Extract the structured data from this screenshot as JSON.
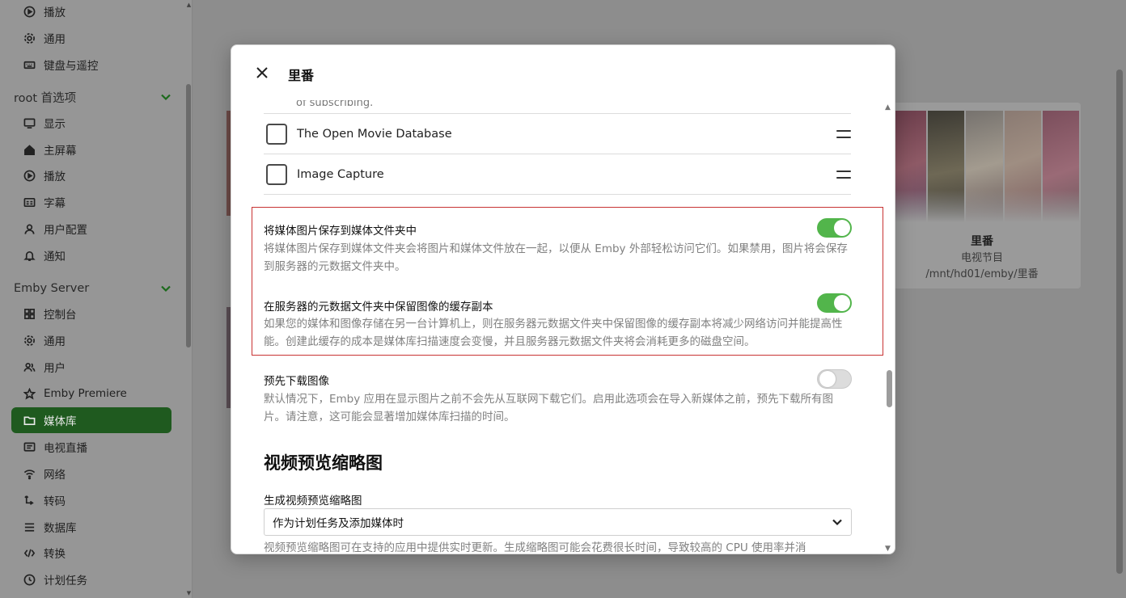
{
  "sidebar": {
    "top_items": [
      {
        "label": "播放",
        "icon": "play-circle-icon"
      },
      {
        "label": "通用",
        "icon": "gear-icon"
      },
      {
        "label": "键盘与遥控",
        "icon": "keyboard-icon"
      }
    ],
    "section_root": {
      "label": "root 首选项"
    },
    "root_items": [
      {
        "label": "显示",
        "icon": "monitor-icon"
      },
      {
        "label": "主屏幕",
        "icon": "home-icon"
      },
      {
        "label": "播放",
        "icon": "play-circle-icon"
      },
      {
        "label": "字幕",
        "icon": "subtitles-icon"
      },
      {
        "label": "用户配置",
        "icon": "user-icon"
      },
      {
        "label": "通知",
        "icon": "bell-icon"
      }
    ],
    "section_server": {
      "label": "Emby Server"
    },
    "server_items": [
      {
        "label": "控制台",
        "icon": "dashboard-icon"
      },
      {
        "label": "通用",
        "icon": "gear-icon"
      },
      {
        "label": "用户",
        "icon": "users-icon"
      },
      {
        "label": "Emby Premiere",
        "icon": "star-icon"
      },
      {
        "label": "媒体库",
        "icon": "folder-icon",
        "active": true
      },
      {
        "label": "电视直播",
        "icon": "tv-icon"
      },
      {
        "label": "网络",
        "icon": "wifi-icon"
      },
      {
        "label": "转码",
        "icon": "transcode-icon"
      },
      {
        "label": "数据库",
        "icon": "database-icon"
      },
      {
        "label": "转换",
        "icon": "convert-icon"
      },
      {
        "label": "计划任务",
        "icon": "clock-icon"
      }
    ]
  },
  "library_card": {
    "title": "里番",
    "type": "电视节目",
    "path": "/mnt/hd01/emby/里番"
  },
  "dialog": {
    "title": "里番",
    "cut_text": "of subscribing.",
    "fetchers": [
      {
        "label": "The Open Movie Database",
        "checked": false
      },
      {
        "label": "Image Capture",
        "checked": false
      }
    ],
    "options": [
      {
        "title": "将媒体图片保存到媒体文件夹中",
        "desc": "将媒体图片保存到媒体文件夹会将图片和媒体文件放在一起，以便从 Emby 外部轻松访问它们。如果禁用，图片将会保存到服务器的元数据文件夹中。",
        "enabled": true
      },
      {
        "title": "在服务器的元数据文件夹中保留图像的缓存副本",
        "desc": "如果您的媒体和图像存储在另一台计算机上，则在服务器元数据文件夹中保留图像的缓存副本将减少网络访问并能提高性能。创建此缓存的成本是媒体库扫描速度会变慢，并且服务器元数据文件夹将会消耗更多的磁盘空间。",
        "enabled": true
      },
      {
        "title": "预先下载图像",
        "desc": "默认情况下，Emby 应用在显示图片之前不会先从互联网下载它们。启用此选项会在导入新媒体之前，预先下载所有图片。请注意，这可能会显著增加媒体库扫描的时间。",
        "enabled": false
      }
    ],
    "section_heading": "视频预览缩略图",
    "thumbnail_select": {
      "label": "生成视频预览缩略图",
      "value": "作为计划任务及添加媒体时",
      "desc": "视频预览缩略图可在支持的应用中提供实时更新。生成缩略图可能会花费很长时间，导致较高的 CPU 使用率并消"
    }
  },
  "colors": {
    "accent": "#52b54b",
    "active_nav": "#1f5a1f",
    "highlight_border": "#c83333"
  }
}
